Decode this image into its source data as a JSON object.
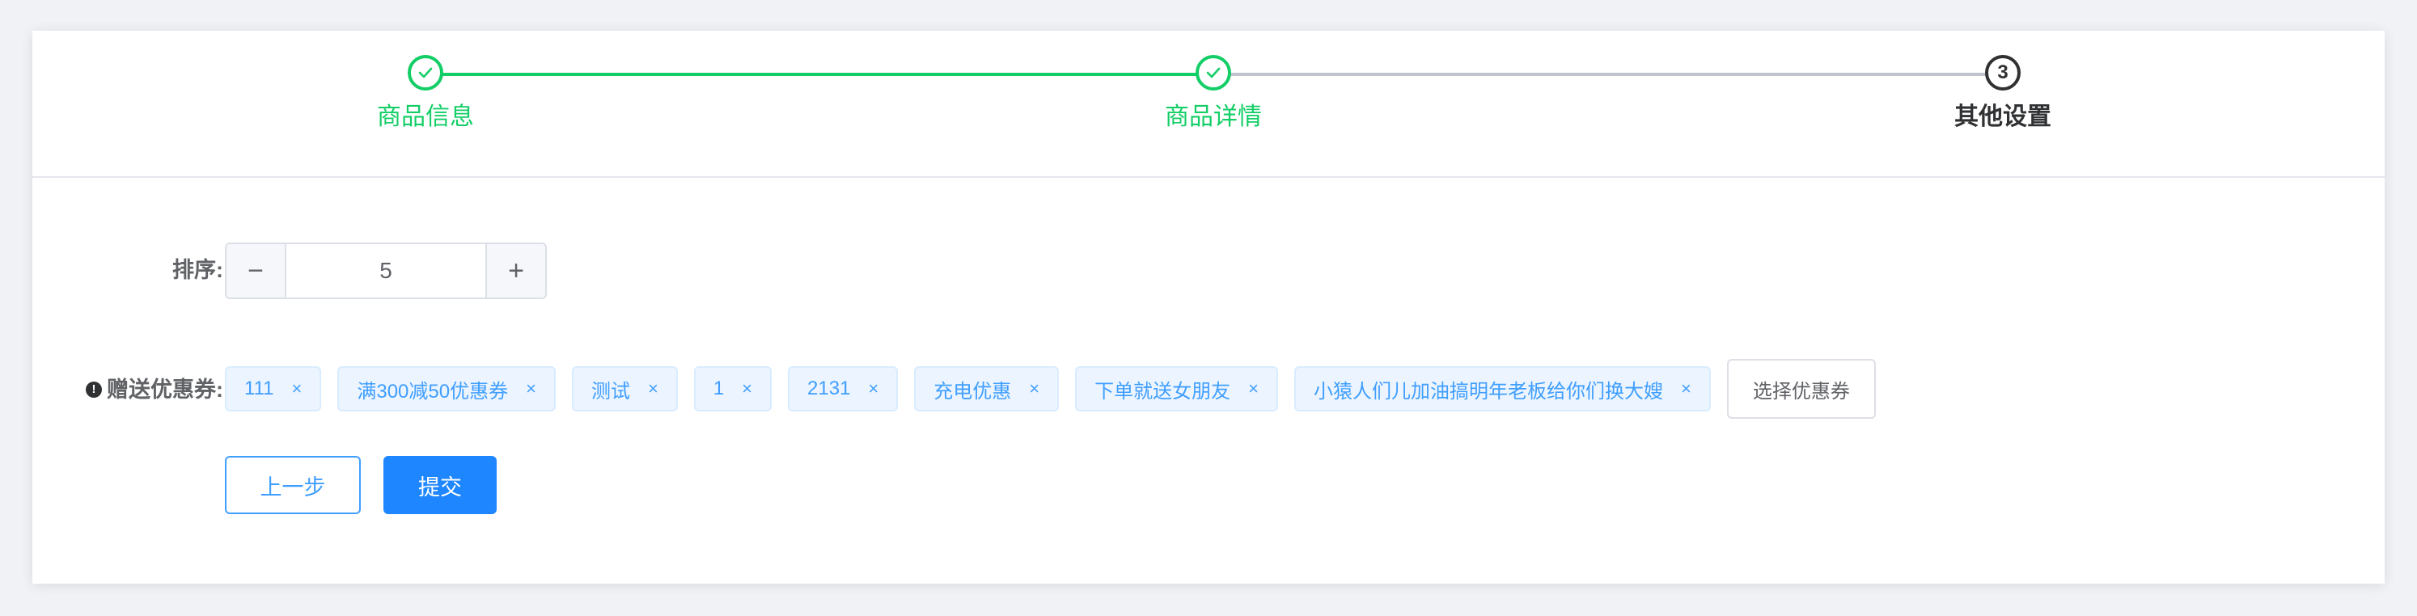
{
  "steps": [
    {
      "title": "商品信息",
      "status": "finish",
      "icon": "check-icon"
    },
    {
      "title": "商品详情",
      "status": "finish",
      "icon": "check-icon"
    },
    {
      "title": "其他设置",
      "status": "process",
      "number": "3"
    }
  ],
  "form": {
    "sort": {
      "label": "排序:",
      "value": "5",
      "minus": "−",
      "plus": "+"
    },
    "coupons": {
      "label": "赠送优惠券:",
      "required_icon": "!",
      "tags": [
        {
          "label": "111"
        },
        {
          "label": "满300减50优惠券"
        },
        {
          "label": "测试"
        },
        {
          "label": "1"
        },
        {
          "label": "2131"
        },
        {
          "label": "充电优惠"
        },
        {
          "label": "下单就送女朋友"
        },
        {
          "label": "小猿人们儿加油搞明年老板给你们换大嫂"
        }
      ],
      "tag_close": "×",
      "select_button": "选择优惠券"
    }
  },
  "actions": {
    "prev": "上一步",
    "submit": "提交"
  },
  "colors": {
    "success": "#13ce66",
    "primary": "#409eff",
    "process": "#303133"
  }
}
